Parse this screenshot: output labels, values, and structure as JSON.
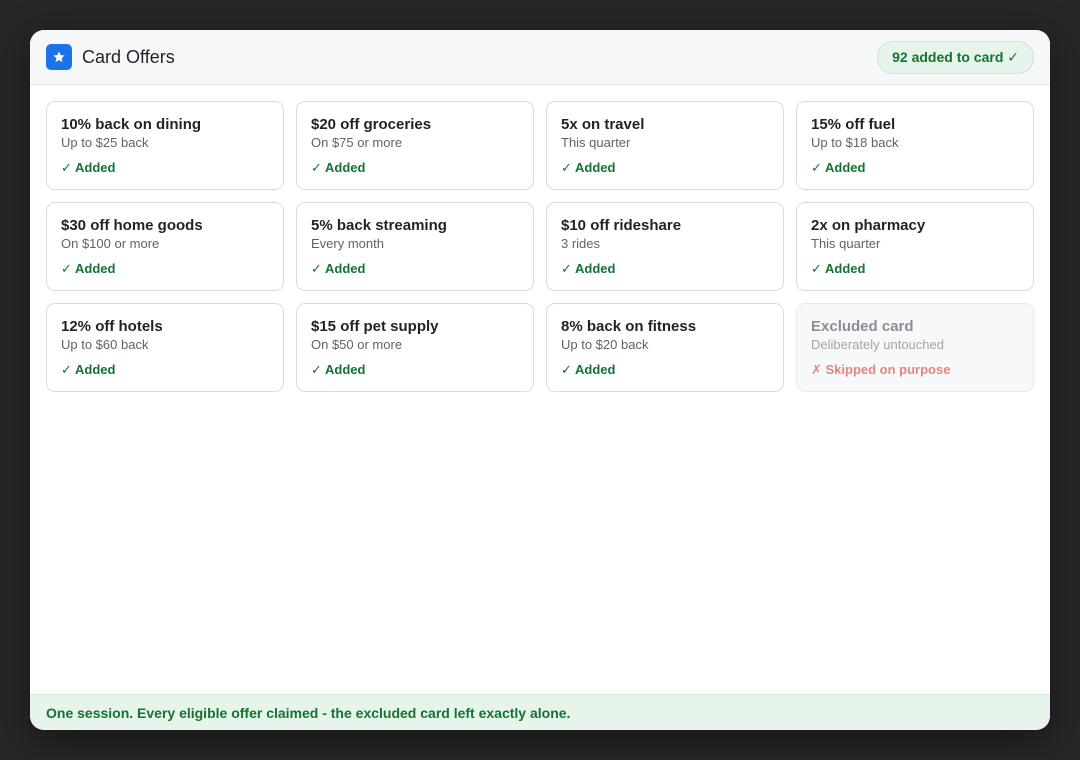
{
  "header": {
    "title": "Card Offers",
    "logo_icon": "star-icon",
    "badge": "92 added to card ✓"
  },
  "colors": {
    "accent": "#1a73e8",
    "success": "#137333",
    "error": "#e1877f"
  },
  "offers": [
    {
      "title": "10% back on dining",
      "subtitle": "Up to $25 back",
      "status": "✓ Added"
    },
    {
      "title": "$20 off groceries",
      "subtitle": "On $75 or more",
      "status": "✓ Added"
    },
    {
      "title": "5x on travel",
      "subtitle": "This quarter",
      "status": "✓ Added"
    },
    {
      "title": "15% off fuel",
      "subtitle": "Up to $18 back",
      "status": "✓ Added"
    },
    {
      "title": "$30 off home goods",
      "subtitle": "On $100 or more",
      "status": "✓ Added"
    },
    {
      "title": "5% back streaming",
      "subtitle": "Every month",
      "status": "✓ Added"
    },
    {
      "title": "$10 off rideshare",
      "subtitle": "3 rides",
      "status": "✓ Added"
    },
    {
      "title": "2x on pharmacy",
      "subtitle": "This quarter",
      "status": "✓ Added"
    },
    {
      "title": "12% off hotels",
      "subtitle": "Up to $60 back",
      "status": "✓ Added"
    },
    {
      "title": "$15 off pet supply",
      "subtitle": "On $50 or more",
      "status": "✓ Added"
    },
    {
      "title": "8% back on fitness",
      "subtitle": "Up to $20 back",
      "status": "✓ Added"
    },
    {
      "title": "Excluded card",
      "subtitle": "Deliberately untouched",
      "status": "✗ Skipped on purpose"
    }
  ],
  "footer": {
    "message": "One session. Every eligible offer claimed - the excluded card left exactly alone."
  }
}
